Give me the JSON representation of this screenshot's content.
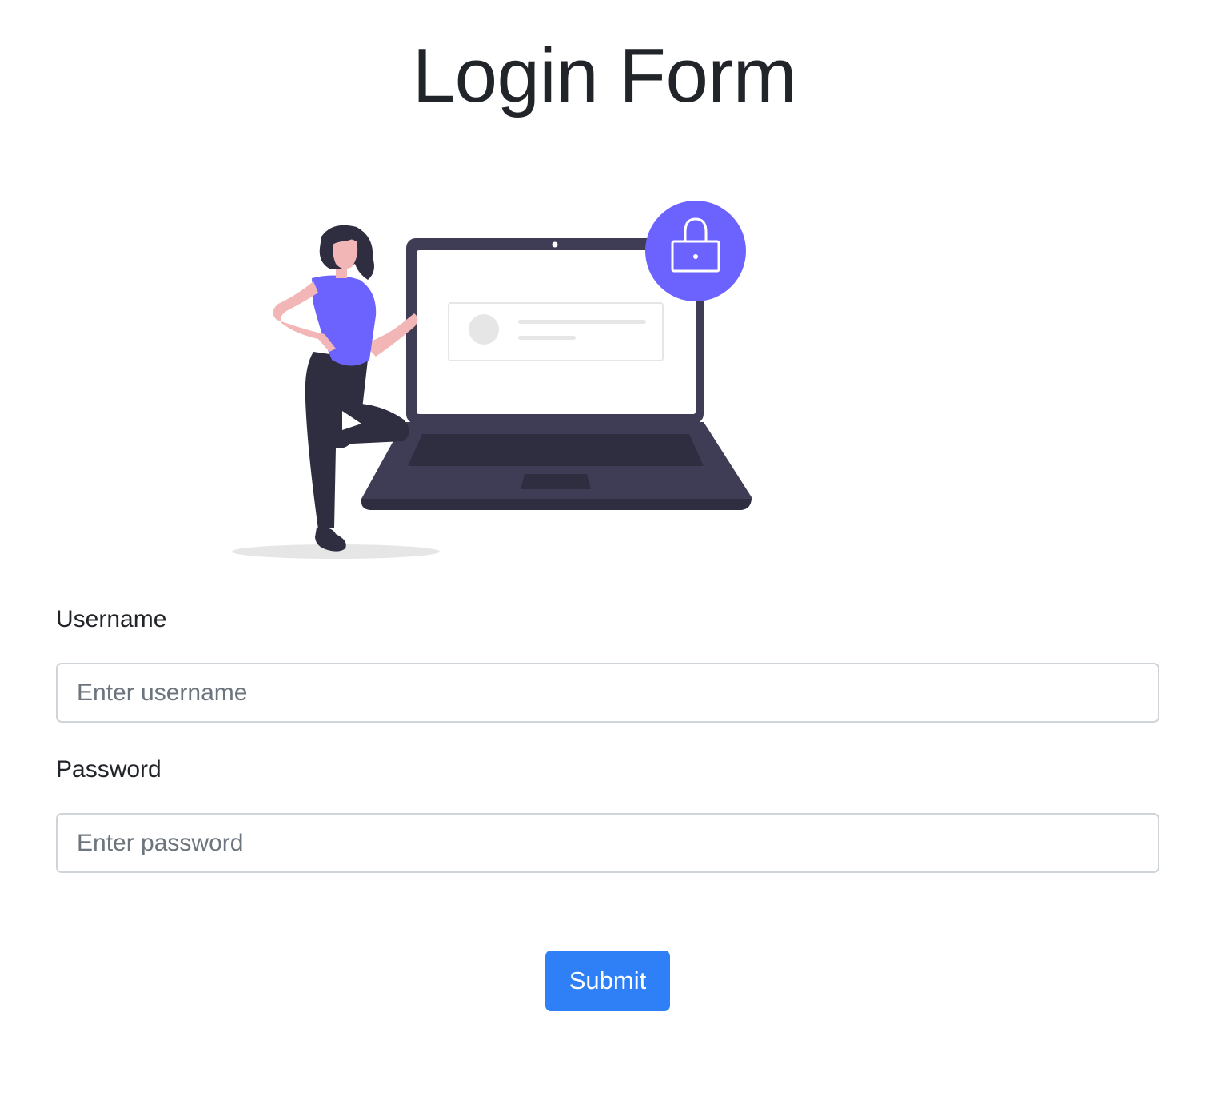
{
  "page": {
    "title": "Login Form"
  },
  "illustration": {
    "icon": "login-security-illustration",
    "accent_color": "#6c63ff"
  },
  "form": {
    "username": {
      "label": "Username",
      "placeholder": "Enter username",
      "value": ""
    },
    "password": {
      "label": "Password",
      "placeholder": "Enter password",
      "value": ""
    },
    "submit_label": "Submit"
  },
  "colors": {
    "button": "#2f80f6",
    "text": "#212529",
    "input_border": "#ced4da",
    "placeholder": "#6c757d"
  }
}
